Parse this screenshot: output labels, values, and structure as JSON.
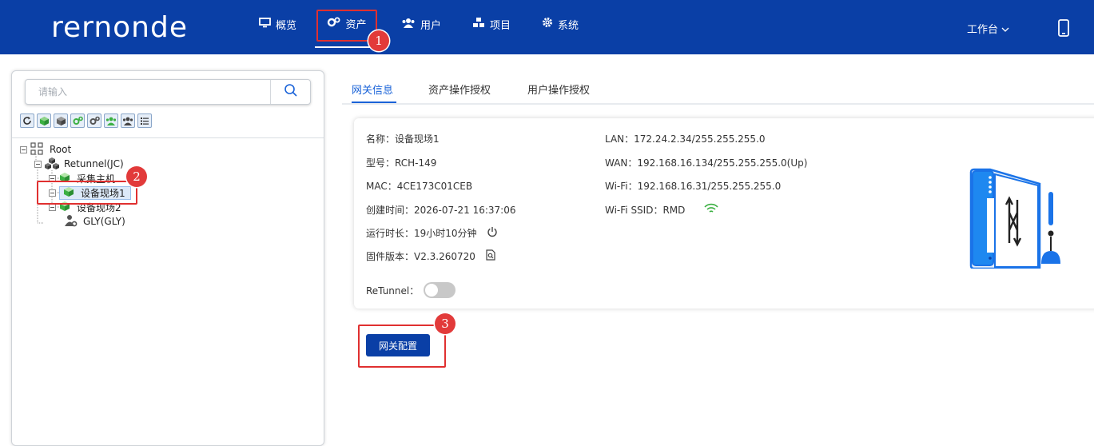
{
  "header": {
    "logo": "rernonde",
    "nav": [
      {
        "label": "概览",
        "icon": "monitor-icon"
      },
      {
        "label": "资产",
        "icon": "cogs-icon"
      },
      {
        "label": "用户",
        "icon": "users-icon"
      },
      {
        "label": "项目",
        "icon": "cubes-icon"
      },
      {
        "label": "系统",
        "icon": "gear-icon"
      }
    ],
    "workbench": "工作台",
    "phone_icon": "mobile-icon"
  },
  "sidebar": {
    "search_placeholder": "请输入",
    "toolbar_icons": [
      "refresh-icon",
      "cube-green-icon",
      "cube-gray-icon",
      "cogs-green-icon",
      "cogs-gray-icon",
      "users-green-icon",
      "users-gray-icon",
      "list-icon"
    ],
    "tree": [
      {
        "label": "Root",
        "icon": "root-icon",
        "level": 0
      },
      {
        "label": "Retunnel(JC)",
        "icon": "cluster-icon",
        "level": 1
      },
      {
        "label": "采集主机",
        "icon": "cube-green-icon",
        "level": 2
      },
      {
        "label": "设备现场1",
        "icon": "cube-green-icon",
        "level": 2,
        "selected": true
      },
      {
        "label": "设备现场2",
        "icon": "cube-green-icon",
        "level": 2
      },
      {
        "label": "GLY(GLY)",
        "icon": "user-gear-icon",
        "level": 1
      }
    ]
  },
  "tabs": [
    "网关信息",
    "资产操作授权",
    "用户操作授权"
  ],
  "info": {
    "name_label": "名称：",
    "name": "设备现场1",
    "model_label": "型号：",
    "model": "RCH-149",
    "mac_label": "MAC：",
    "mac": "4CE173C01CEB",
    "created_label": "创建时间：",
    "created": "2026-07-21 16:37:06",
    "uptime_label": "运行时长：",
    "uptime": "19小时10分钟",
    "firmware_label": "固件版本：",
    "firmware": "V2.3.260720",
    "lan_label": "LAN：",
    "lan": "172.24.2.34/255.255.255.0",
    "wan_label": "WAN：",
    "wan": "192.168.16.134/255.255.255.0(Up)",
    "wifi_label": "Wi-Fi：",
    "wifi": "192.168.16.31/255.255.255.0",
    "ssid_label": "Wi-Fi SSID：",
    "ssid": "RMD",
    "retunnel_label": "ReTunnel：",
    "retunnel_on": false
  },
  "config_button": "网关配置",
  "annotations": [
    "1",
    "2",
    "3"
  ],
  "colors": {
    "primary": "#0a3fa6",
    "accent": "#1a63d8",
    "highlight": "#e03030",
    "green": "#3cb043"
  }
}
